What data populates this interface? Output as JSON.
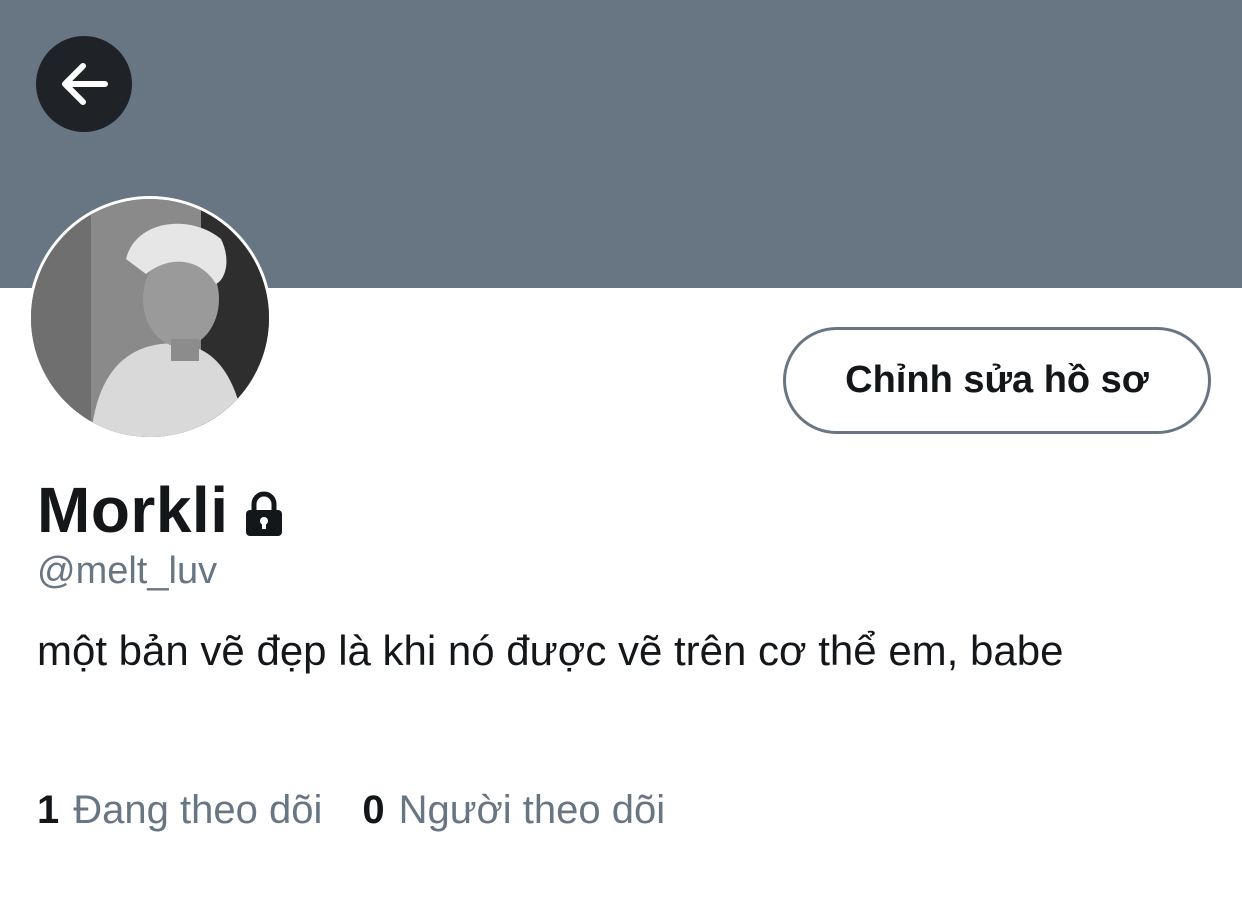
{
  "profile": {
    "display_name": "Morkli",
    "handle": "@melt_luv",
    "bio": "một bản vẽ đẹp là khi nó được vẽ trên cơ thể em, babe",
    "protected": true
  },
  "actions": {
    "edit_profile_label": "Chỉnh sửa hồ sơ"
  },
  "stats": {
    "following_count": "1",
    "following_label": "Đang theo dõi",
    "followers_count": "0",
    "followers_label": "Người theo dõi"
  },
  "icons": {
    "back": "arrow-left-icon",
    "lock": "lock-icon"
  },
  "colors": {
    "banner": "#687684",
    "text_primary": "#14171a",
    "text_secondary": "#687684",
    "back_button_bg": "#1f2328"
  }
}
